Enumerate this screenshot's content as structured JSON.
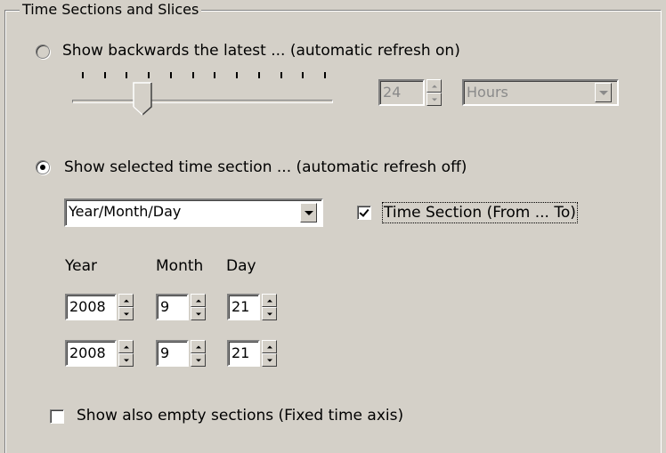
{
  "group": {
    "title": "Time Sections and Slices"
  },
  "latest": {
    "label": "Show backwards the latest ... (automatic refresh on)",
    "selected": false,
    "slider_position_fraction": 0.25,
    "tick_count": 12,
    "value": "24",
    "unit": "Hours"
  },
  "section": {
    "label": "Show selected time section ... (automatic refresh off)",
    "selected": true,
    "granularity": "Year/Month/Day",
    "time_section_checkbox": {
      "label": "Time Section (From ... To)",
      "checked": true
    },
    "headers": {
      "year": "Year",
      "month": "Month",
      "day": "Day"
    },
    "from": {
      "year": "2008",
      "month": "9",
      "day": "21"
    },
    "to": {
      "year": "2008",
      "month": "9",
      "day": "21"
    }
  },
  "empty_sections": {
    "label": "Show also empty sections (Fixed time axis)",
    "checked": false
  },
  "colors": {
    "background": "#d4d0c8",
    "disabled_text": "#8a8a8a"
  }
}
